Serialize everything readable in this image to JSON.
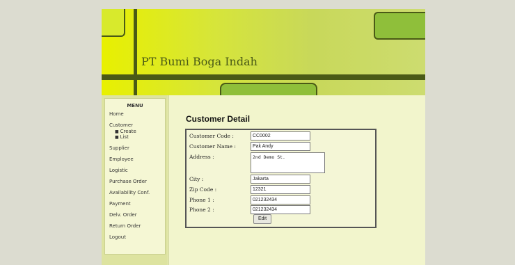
{
  "header": {
    "title": "PT Bumi Boga Indah"
  },
  "menu": {
    "title": "MENU",
    "items": [
      {
        "label": "Home"
      },
      {
        "label": "Customer"
      },
      {
        "label": "Supplier"
      },
      {
        "label": "Employee"
      },
      {
        "label": "Logistic"
      },
      {
        "label": "Purchase Order"
      },
      {
        "label": "Availability Conf."
      },
      {
        "label": "Payment"
      },
      {
        "label": "Delv. Order"
      },
      {
        "label": "Return Order"
      },
      {
        "label": "Logout"
      }
    ],
    "customer_sub": [
      {
        "label": "Create"
      },
      {
        "label": "List"
      }
    ]
  },
  "main": {
    "heading": "Customer Detail",
    "fields": {
      "code": {
        "label": "Customer Code :",
        "value": "CC0002"
      },
      "name": {
        "label": "Customer Name :",
        "value": "Pak Andy"
      },
      "address": {
        "label": "Address :",
        "value": "2nd Demo St."
      },
      "city": {
        "label": "City :",
        "value": "Jakarta"
      },
      "zip": {
        "label": "Zip Code :",
        "value": "12321"
      },
      "phone1": {
        "label": "Phone 1 :",
        "value": "021232434"
      },
      "phone2": {
        "label": "Phone 2 :",
        "value": "021232434"
      }
    },
    "edit_label": "Edit"
  }
}
